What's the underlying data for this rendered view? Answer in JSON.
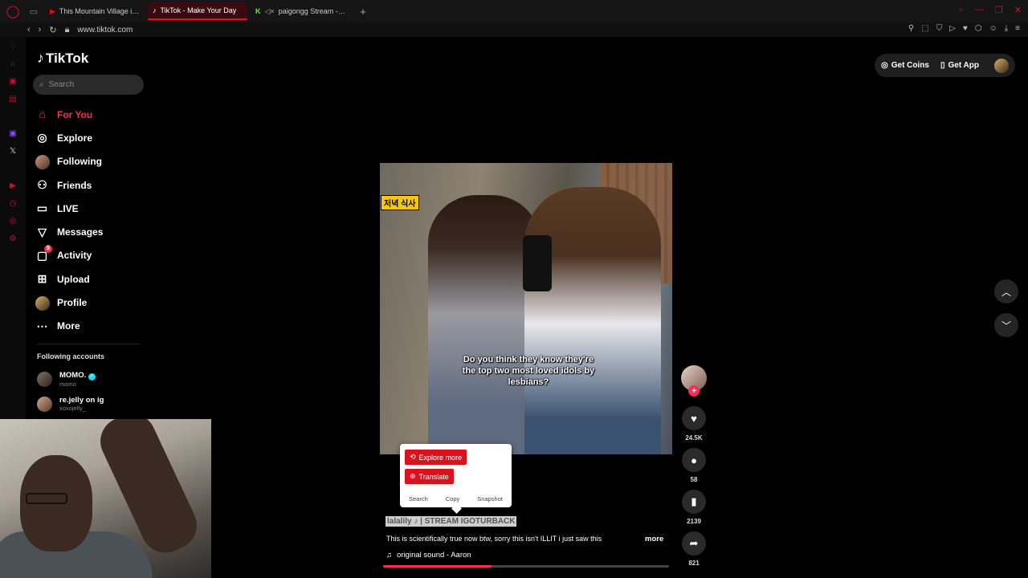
{
  "browser": {
    "tabs": [
      {
        "title": "This Mountain Village in Japan",
        "favicon": "youtube-icon",
        "active": false
      },
      {
        "title": "TikTok - Make Your Day",
        "favicon": "tiktok-icon",
        "active": true
      },
      {
        "title": "paigongg Stream - Watch",
        "favicon": "kick-icon",
        "active": false
      }
    ],
    "url": "www.tiktok.com"
  },
  "sidebar": {
    "logo": "TikTok",
    "search_placeholder": "Search",
    "nav": [
      {
        "label": "For You",
        "icon": "home-icon",
        "active": true
      },
      {
        "label": "Explore",
        "icon": "compass-icon"
      },
      {
        "label": "Following",
        "icon": "following-avatar-icon"
      },
      {
        "label": "Friends",
        "icon": "friends-icon"
      },
      {
        "label": "LIVE",
        "icon": "live-icon"
      },
      {
        "label": "Messages",
        "icon": "messages-icon"
      },
      {
        "label": "Activity",
        "icon": "activity-icon",
        "badge": "5"
      },
      {
        "label": "Upload",
        "icon": "upload-icon"
      },
      {
        "label": "Profile",
        "icon": "profile-avatar-icon"
      },
      {
        "label": "More",
        "icon": "more-icon"
      }
    ],
    "following_title": "Following accounts",
    "accounts": [
      {
        "name": "MOMO.",
        "handle": "momo",
        "verified": true
      },
      {
        "name": "re.jelly on ig",
        "handle": "xoxojelly_"
      }
    ]
  },
  "header": {
    "get_coins": "Get Coins",
    "get_app": "Get App"
  },
  "video": {
    "tag": "저녁 식사",
    "overlay_text": "Do you think they know they're the top two most loved idols by lesbians?",
    "author_line": "lalalily ♪ | STREAM IGOTURBACK",
    "description": "This is scientifically true now btw, sorry this isn't ILLIT i just saw this",
    "more": "more",
    "music": "original sound - Aaron",
    "progress": 0.38
  },
  "context_menu": {
    "explore_more": "Explore more",
    "translate": "Translate",
    "search": "Search",
    "copy": "Copy",
    "snapshot": "Snapshot"
  },
  "actions": {
    "likes": "24.5K",
    "comments": "58",
    "saves": "2139",
    "shares": "821"
  },
  "colors": {
    "accent": "#fe2c55",
    "opera_red": "#e0112b"
  }
}
